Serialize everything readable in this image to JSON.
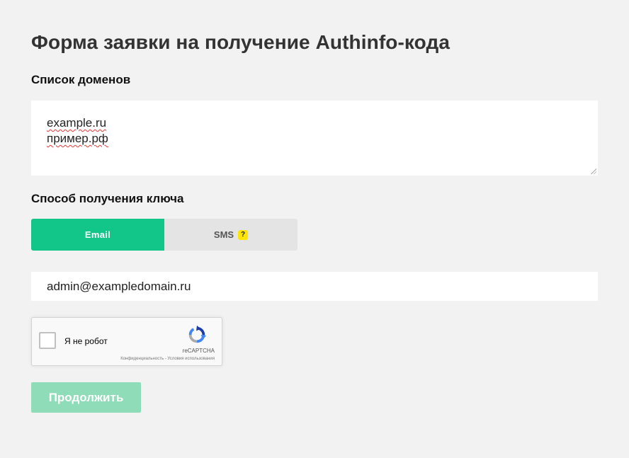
{
  "page": {
    "title": "Форма заявки на получение Authinfo-кода"
  },
  "domains": {
    "label": "Список доменов",
    "lines": [
      "example.ru",
      "пример.рф"
    ]
  },
  "key_method": {
    "label": "Способ получения ключа",
    "options": [
      {
        "label": "Email",
        "selected": true
      },
      {
        "label": "SMS",
        "selected": false,
        "help_badge": "?"
      }
    ]
  },
  "email_field": {
    "value": "admin@exampledomain.ru"
  },
  "captcha": {
    "label": "Я не робот",
    "brand": "reCAPTCHA",
    "terms": "Конфиденциальность - Условия использования",
    "icon": "recaptcha-logo-icon"
  },
  "submit": {
    "label": "Продолжить"
  },
  "colors": {
    "background": "#f2f2f2",
    "accent": "#12c68a",
    "accent_disabled": "#8fdcb9",
    "help_badge": "#ffe600"
  }
}
